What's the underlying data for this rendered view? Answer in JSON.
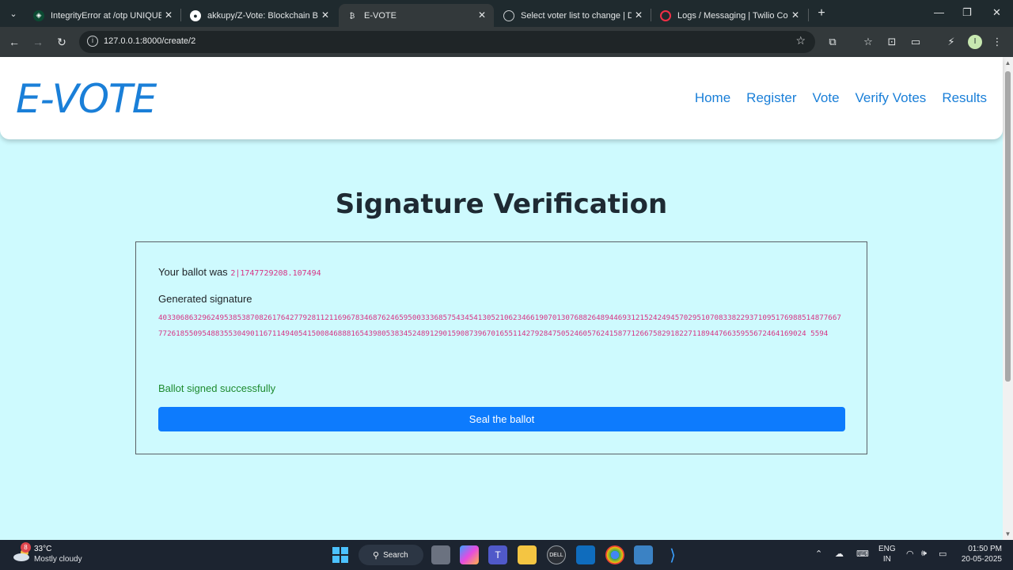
{
  "browser": {
    "tabs": [
      {
        "title": "IntegrityError at /otp UNIQUE c",
        "active": false
      },
      {
        "title": "akkupy/Z-Vote: Blockchain Base",
        "active": false
      },
      {
        "title": "E-VOTE",
        "active": true
      },
      {
        "title": "Select voter list to change | Dja",
        "active": false
      },
      {
        "title": "Logs / Messaging | Twilio Conso",
        "active": false
      }
    ],
    "url": "127.0.0.1:8000/create/2",
    "profile_initial": "I"
  },
  "site": {
    "logo": "E-VOTE",
    "nav": [
      "Home",
      "Register",
      "Vote",
      "Verify Votes",
      "Results"
    ]
  },
  "page": {
    "title": "Signature Verification",
    "ballot_label": "Your ballot was",
    "ballot_value": "2|1747729208.107494",
    "signature_label": "Generated signature",
    "signature_value": "4033068632962495385387082617642779281121169678346876246595003336857543454130521062346619070130768826489446931215242494570295107083382293710951769885148776677726185509548835530490116711494054150084688816543980538345248912901590873967016551142792847505246057624158771266758291822711894476635955672464169024 5594",
    "status_message": "Ballot signed successfully",
    "seal_button": "Seal the ballot"
  },
  "taskbar": {
    "weather_badge": "8",
    "temperature": "33°C",
    "condition": "Mostly cloudy",
    "search": "Search",
    "lang_1": "ENG",
    "lang_2": "IN",
    "time": "01:50 PM",
    "date": "20-05-2025"
  }
}
